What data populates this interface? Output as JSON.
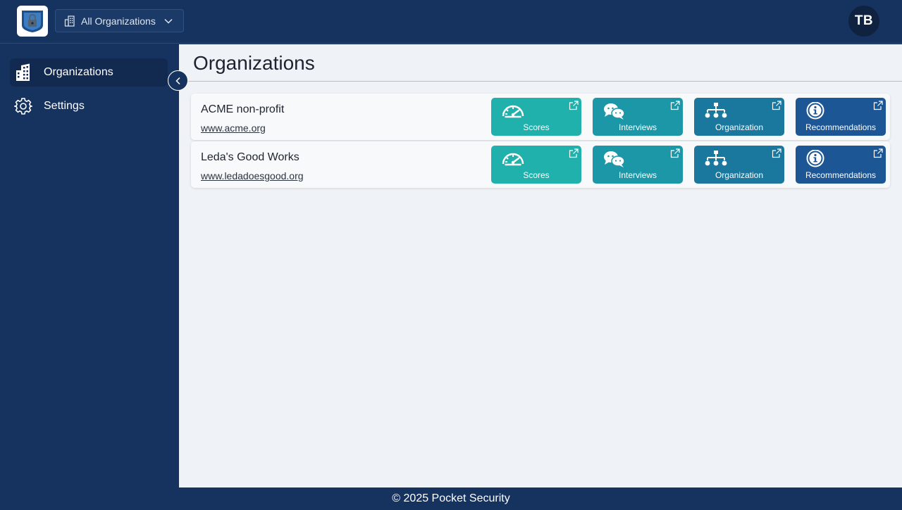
{
  "header": {
    "org_selector_label": "All Organizations",
    "avatar_initials": "TB"
  },
  "sidebar": {
    "items": [
      {
        "label": "Organizations",
        "icon": "building-icon",
        "active": true
      },
      {
        "label": "Settings",
        "icon": "gear-icon",
        "active": false
      }
    ]
  },
  "main": {
    "title": "Organizations",
    "organizations": [
      {
        "name": "ACME non-profit",
        "url": "www.acme.org",
        "actions": [
          "Scores",
          "Interviews",
          "Organization",
          "Recommendations"
        ]
      },
      {
        "name": "Leda's Good Works",
        "url": "www.ledadoesgood.org",
        "actions": [
          "Scores",
          "Interviews",
          "Organization",
          "Recommendations"
        ]
      }
    ]
  },
  "footer": {
    "text": "© 2025 Pocket Security"
  },
  "colors": {
    "navy": "#163360",
    "scores": "#20b1ad",
    "interviews": "#1b97a8",
    "organization": "#1a779e",
    "recommendations": "#1d5694"
  }
}
